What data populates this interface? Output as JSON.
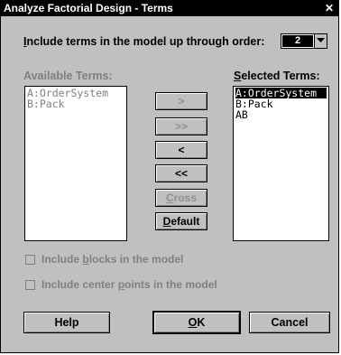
{
  "window": {
    "title": "Analyze Factorial Design - Terms",
    "close_glyph": "✕"
  },
  "order": {
    "label_prefix": "I",
    "label_rest": "nclude terms in the model up through order:",
    "value": "2"
  },
  "available_terms": {
    "label_prefix": "A",
    "label_rest": "vailable Terms:",
    "items": [
      "A:OrderSystem",
      "B:Pack"
    ]
  },
  "selected_terms": {
    "label_prefix": "S",
    "label_rest": "elected Terms:",
    "items": [
      "A:OrderSystem",
      "B:Pack",
      "AB"
    ]
  },
  "transfer_buttons": {
    "add": ">",
    "add_all": ">>",
    "remove": "<",
    "remove_all": "<<",
    "cross_prefix": "C",
    "cross_rest": "ross",
    "default_prefix": "D",
    "default_rest": "efault"
  },
  "options": {
    "blocks_a": "Include ",
    "blocks_u": "b",
    "blocks_b": "locks in the model",
    "center_a": "Include center ",
    "center_u": "p",
    "center_b": "oints in the model"
  },
  "footer": {
    "help": "Help",
    "ok_prefix": "O",
    "ok_rest": "K",
    "cancel": "Cancel"
  },
  "icons": {
    "combo_arrow": "chevron-down-icon",
    "close": "close-icon"
  },
  "colors": {
    "face": "#c0c0c0",
    "disabled_text": "#808080",
    "selection": "#000000"
  }
}
